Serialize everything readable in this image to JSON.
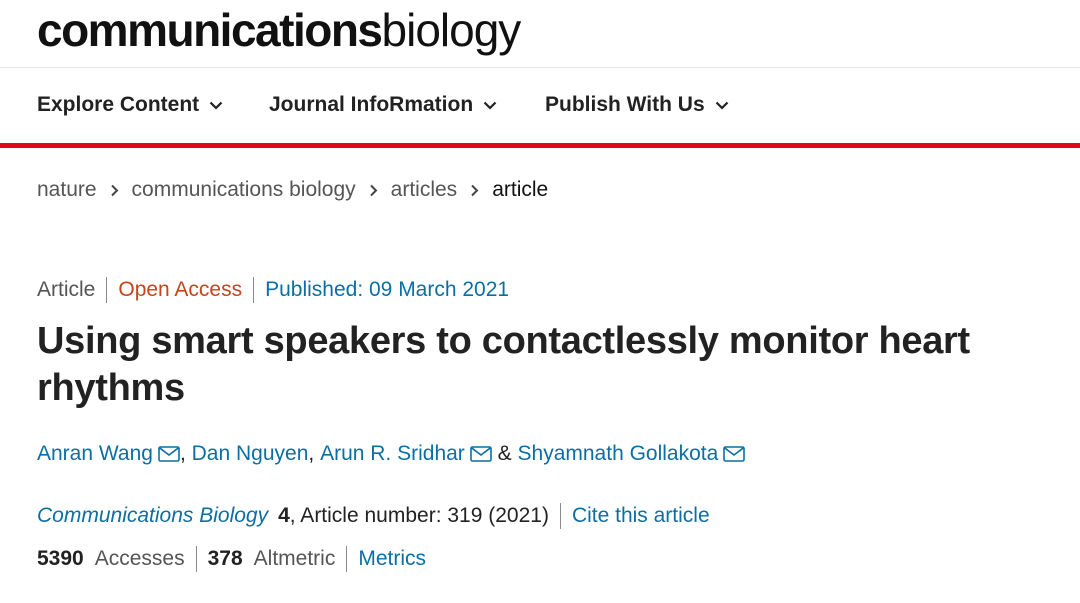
{
  "brand": {
    "bold": "communications",
    "light": "biology"
  },
  "nav": [
    {
      "label": "Explore Content"
    },
    {
      "label": "Journal InfoRmation"
    },
    {
      "label": "Publish With Us"
    }
  ],
  "breadcrumb": [
    "nature",
    "communications biology",
    "articles",
    "article"
  ],
  "article": {
    "type": "Article",
    "access": "Open Access",
    "published": "Published: 09 March 2021",
    "title": "Using smart speakers to contactlessly monitor heart rhythms",
    "authors": {
      "a1": "Anran Wang",
      "a2": "Dan Nguyen",
      "a3": "Arun R. Sridhar",
      "a4": "Shyamnath Gollakota",
      "sep_comma": ",",
      "sep_and": "&"
    },
    "journal": "Communications Biology",
    "volume": "4",
    "article_number": ", Article number: 319 (2021)",
    "cite_link": "Cite this article",
    "accesses_count": "5390",
    "accesses_label": "Accesses",
    "altmetric_count": "378",
    "altmetric_label": "Altmetric",
    "metrics_link": "Metrics"
  },
  "colors": {
    "accent_red": "#e30613",
    "link_blue": "#0c6fa3",
    "open_access_orange": "#c4441c"
  },
  "icons": {
    "nav_dropdown": "chevron-down-icon",
    "breadcrumb_sep": "chevron-right-icon",
    "author_contact": "mail-icon"
  }
}
